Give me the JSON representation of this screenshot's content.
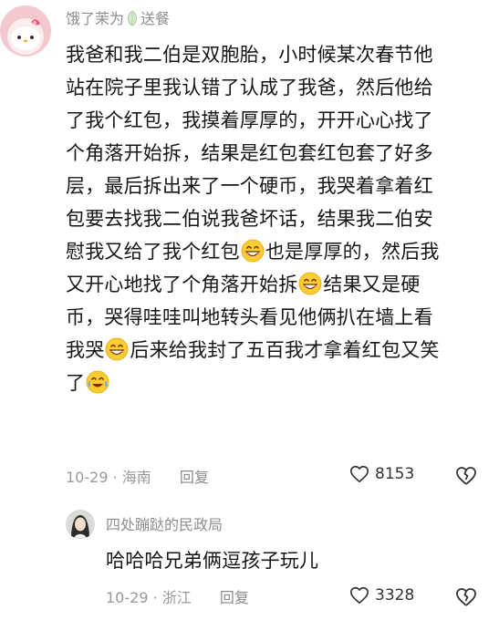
{
  "comments": [
    {
      "username": "饿了茉为",
      "username_suffix": "送餐",
      "lines": [
        [
          "我爸和我二伯是双胞胎，小时候某次春节他"
        ],
        [
          "站在院子里我认错了认成了我爸，然后他给"
        ],
        [
          "了我个红包，我摸着厚厚的，开开心心找了"
        ],
        [
          "个角落开始拆，结果是红包套红包套了好多"
        ],
        [
          "层，最后拆出来了一个硬币，我哭着拿着红"
        ],
        [
          "包要去找我二伯说我爸坏话，结果我二伯安"
        ],
        [
          "慰我又给了我个红包",
          "😁",
          "也是厚厚的，然后我"
        ],
        [
          "又开心地找了个角落开始拆",
          "😁",
          "结果又是硬"
        ],
        [
          "币，哭得哇哇叫地转头看见他俩扒在墙上看"
        ],
        [
          "我哭",
          "😁",
          "后来给我封了五百我才拿着红包又笑"
        ],
        [
          "了",
          "😂"
        ]
      ],
      "date": "10-29",
      "location": "海南",
      "reply_label": "回复",
      "likes": "8153"
    },
    {
      "username": "四处蹦跶的民政局",
      "text": "哈哈哈兄弟俩逗孩子玩儿",
      "date": "10-29",
      "location": "浙江",
      "reply_label": "回复",
      "likes": "3328"
    }
  ],
  "icons": {
    "leaf": "leaf-icon",
    "emoji_grin": "grinning-face-emoji",
    "emoji_tears": "tears-of-joy-emoji",
    "like": "heart-outline-icon",
    "dislike": "broken-heart-icon"
  },
  "colors": {
    "text": "#161616",
    "secondary": "#8f8f8f",
    "background": "#ffffff"
  }
}
